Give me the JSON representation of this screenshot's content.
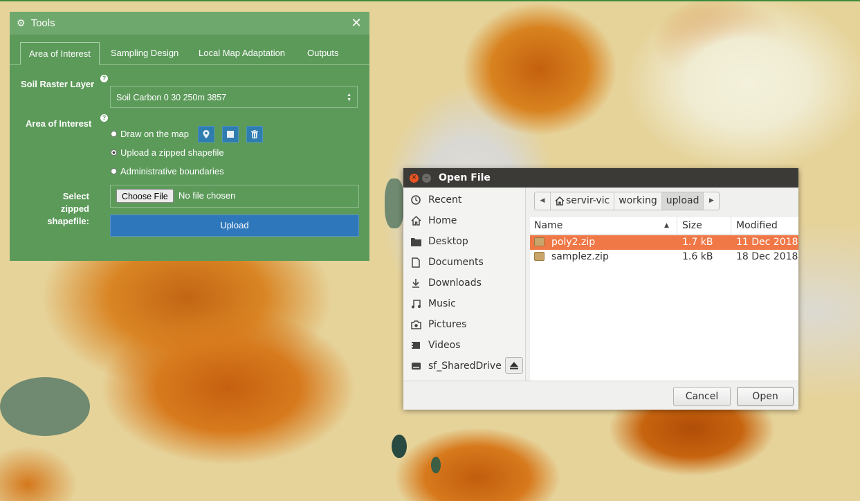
{
  "tools_panel": {
    "title": "Tools",
    "icon": "gear-icon",
    "close_icon": "close-icon",
    "tabs": [
      {
        "label": "Area of Interest",
        "active": true
      },
      {
        "label": "Sampling Design",
        "active": false
      },
      {
        "label": "Local Map Adaptation",
        "active": false
      },
      {
        "label": "Outputs",
        "active": false
      }
    ],
    "soil_raster_label": "Soil Raster Layer",
    "soil_raster_value": "Soil Carbon 0 30 250m 3857",
    "aoi_label": "Area of Interest",
    "help_glyph": "?",
    "options": [
      {
        "label": "Draw on the map",
        "selected": false
      },
      {
        "label": "Upload a zipped shapefile",
        "selected": true
      },
      {
        "label": "Administrative boundaries",
        "selected": false
      }
    ],
    "draw_tools": [
      "map-marker-icon",
      "rectangle-icon",
      "trash-icon"
    ],
    "select_shapefile_label_1": "Select zipped",
    "select_shapefile_label_2": "shapefile:",
    "choose_file_label": "Choose File",
    "no_file_text": "No file chosen",
    "upload_label": "Upload",
    "colors": {
      "panel": "#5c9a5a",
      "header": "#6fa86d",
      "button": "#2f77bb"
    }
  },
  "dialog": {
    "title": "Open File",
    "places": [
      {
        "label": "Recent",
        "icon": "clock-icon"
      },
      {
        "label": "Home",
        "icon": "home-icon"
      },
      {
        "label": "Desktop",
        "icon": "folder-icon"
      },
      {
        "label": "Documents",
        "icon": "document-icon"
      },
      {
        "label": "Downloads",
        "icon": "download-icon"
      },
      {
        "label": "Music",
        "icon": "music-icon"
      },
      {
        "label": "Pictures",
        "icon": "camera-icon"
      },
      {
        "label": "Videos",
        "icon": "video-icon"
      },
      {
        "label": "sf_SharedDrive",
        "icon": "drive-icon"
      }
    ],
    "breadcrumbs": [
      "servir-vic",
      "working",
      "upload"
    ],
    "columns": {
      "name": "Name",
      "size": "Size",
      "modified": "Modified"
    },
    "files": [
      {
        "name": "poly2.zip",
        "size": "1.7 kB",
        "modified": "11 Dec 2018",
        "selected": true
      },
      {
        "name": "samplez.zip",
        "size": "1.6 kB",
        "modified": "18 Dec 2018",
        "selected": false
      }
    ],
    "cancel_label": "Cancel",
    "open_label": "Open",
    "colors": {
      "titlebar": "#3b3a36",
      "selection": "#f07746",
      "close": "#e95420"
    }
  }
}
